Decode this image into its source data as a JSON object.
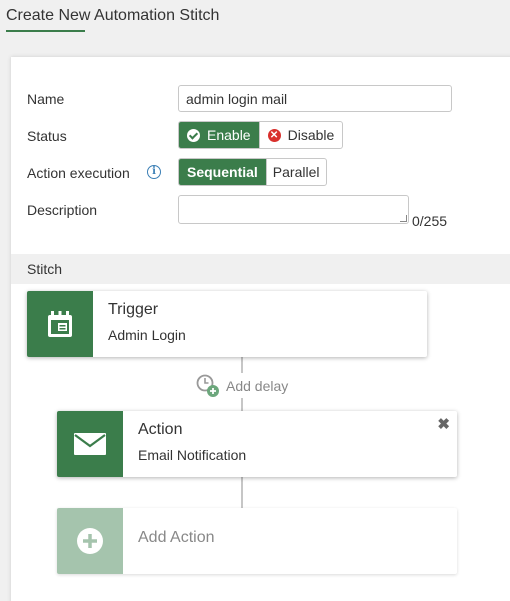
{
  "header": {
    "title": "Create New Automation Stitch"
  },
  "form": {
    "name_label": "Name",
    "name_value": "admin login mail",
    "status_label": "Status",
    "status_enable": "Enable",
    "status_disable": "Disable",
    "status_selected": "Enable",
    "action_exec_label": "Action execution",
    "action_sequential": "Sequential",
    "action_parallel": "Parallel",
    "action_selected": "Sequential",
    "description_label": "Description",
    "description_value": "",
    "description_counter": "0/255"
  },
  "stitch": {
    "section_label": "Stitch",
    "trigger": {
      "title": "Trigger",
      "subtitle": "Admin Login",
      "icon": "calendar-icon"
    },
    "add_delay_label": "Add delay",
    "action": {
      "title": "Action",
      "subtitle": "Email Notification",
      "icon": "envelope-icon"
    },
    "add_action_label": "Add Action"
  },
  "colors": {
    "accent": "#3b7d4b",
    "accent_light": "#a5c4ad",
    "disable_red": "#d9302c",
    "info_blue": "#3b7fb5"
  }
}
